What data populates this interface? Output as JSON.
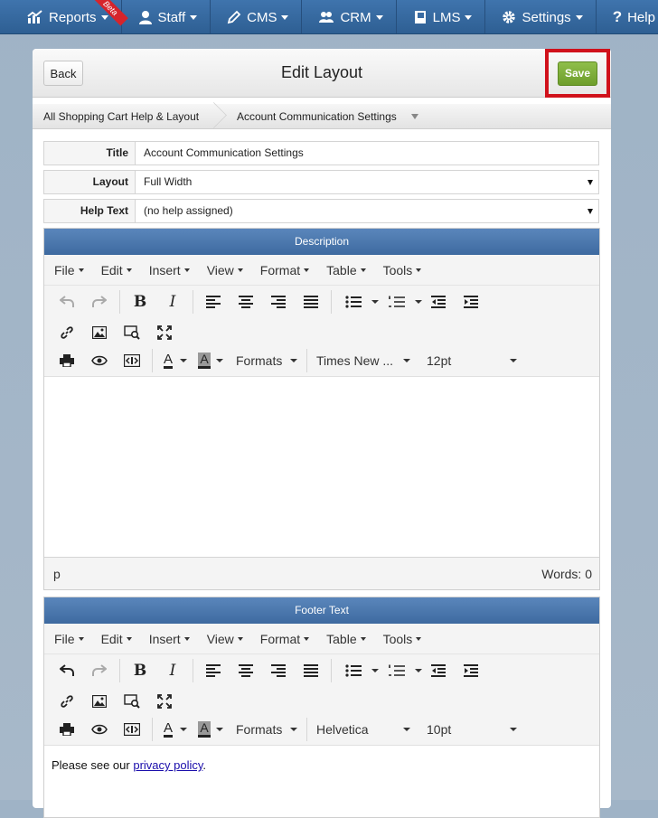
{
  "nav": {
    "items": [
      {
        "label": "Reports",
        "icon": "bar-chart-icon"
      },
      {
        "label": "Staff",
        "icon": "user-icon"
      },
      {
        "label": "CMS",
        "icon": "pencil-icon"
      },
      {
        "label": "CRM",
        "icon": "users-icon"
      },
      {
        "label": "LMS",
        "icon": "book-icon"
      },
      {
        "label": "Settings",
        "icon": "gear-icon"
      },
      {
        "label": "Help",
        "icon": "question-icon"
      }
    ],
    "beta_badge": "Beta"
  },
  "header": {
    "back_label": "Back",
    "title": "Edit Layout",
    "save_label": "Save"
  },
  "breadcrumb": {
    "parent": "All Shopping Cart Help & Layout",
    "current": "Account Communication Settings"
  },
  "form": {
    "title_label": "Title",
    "title_value": "Account Communication Settings",
    "layout_label": "Layout",
    "layout_value": "Full Width",
    "help_label": "Help Text",
    "help_value": "(no help assigned)"
  },
  "menu": [
    "File",
    "Edit",
    "Insert",
    "View",
    "Format",
    "Table",
    "Tools"
  ],
  "description_editor": {
    "title": "Description",
    "formats_label": "Formats",
    "font_family": "Times New ...",
    "font_size": "12pt",
    "status_path": "p",
    "word_count": "Words: 0"
  },
  "footer_editor": {
    "title": "Footer Text",
    "formats_label": "Formats",
    "font_family": "Helvetica",
    "font_size": "10pt",
    "content_prefix": "Please see our ",
    "content_link": "privacy policy",
    "content_suffix": "."
  },
  "colors": {
    "nav_bg": "#3a6ca3",
    "editor_title_bg": "#4a78b0",
    "save_bg": "#7cae3a",
    "highlight_border": "#d0111b",
    "link": "#1a0dab"
  }
}
